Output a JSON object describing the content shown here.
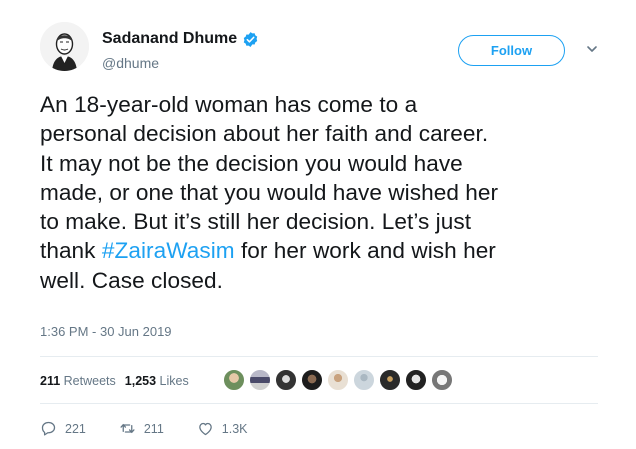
{
  "author": {
    "display_name": "Sadanand Dhume",
    "handle": "@dhume",
    "verified_icon": "verified-badge-icon",
    "avatar_icon": "avatar"
  },
  "follow_label": "Follow",
  "tweet": {
    "lines": [
      "An 18-year-old woman has come to a",
      "personal decision about her faith and career.",
      "It may not be the decision you would have",
      "made, or one that you would have wished her",
      "to make. But it’s still her decision. Let’s just"
    ],
    "line6_before": "thank ",
    "hashtag": "#ZairaWasim",
    "line6_after": " for her work and wish her",
    "line7": "well. Case closed."
  },
  "timestamp": "1:36 PM - 30 Jun 2019",
  "stats": {
    "retweets_count": "211",
    "retweets_label": "Retweets",
    "likes_count": "1,253",
    "likes_label": "Likes"
  },
  "actions": {
    "replies": "221",
    "retweets": "211",
    "likes": "1.3K"
  },
  "colors": {
    "accent": "#1da1f2",
    "text": "#14171a",
    "secondary": "#657786"
  }
}
